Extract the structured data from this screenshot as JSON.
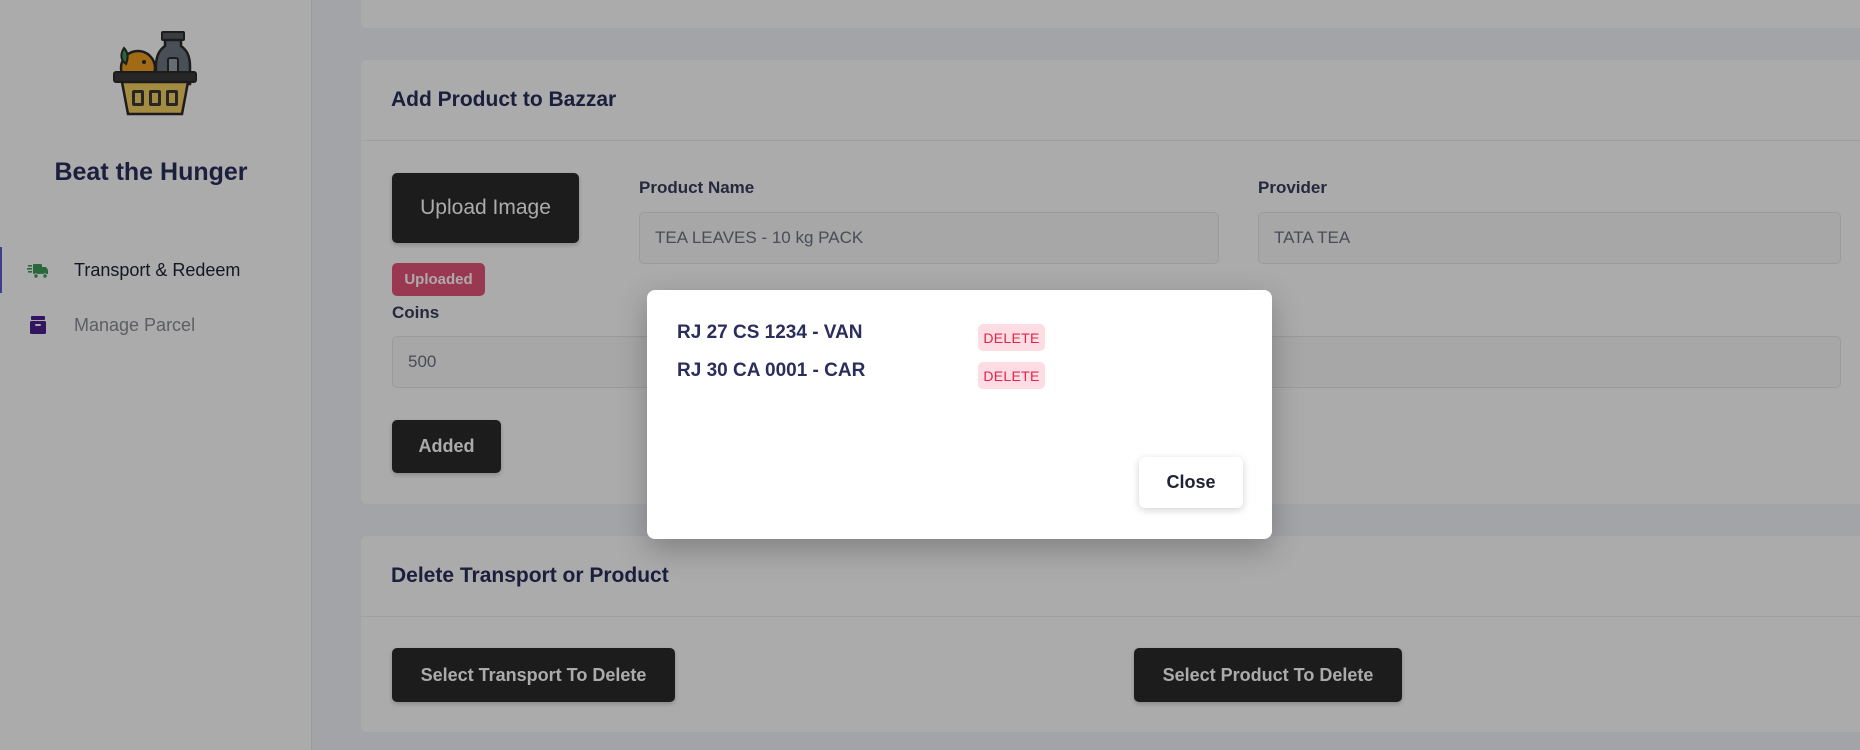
{
  "sidebar": {
    "brand": "Beat the Hunger",
    "items": [
      {
        "label": "Transport & Redeem",
        "icon": "delivery-truck-icon"
      },
      {
        "label": "Manage Parcel",
        "icon": "parcel-box-icon"
      }
    ]
  },
  "add_product": {
    "title": "Add Product to Bazzar",
    "upload_label": "Upload Image",
    "uploaded_badge": "Uploaded",
    "product_name_label": "Product Name",
    "product_name_value": "TEA LEAVES - 10 kg PACK",
    "provider_label": "Provider",
    "provider_value": "TATA TEA",
    "coins_label": "Coins",
    "coins_value": "500",
    "added_label": "Added"
  },
  "delete_section": {
    "title": "Delete Transport or Product",
    "select_transport_label": "Select Transport To Delete",
    "select_product_label": "Select Product To Delete"
  },
  "modal": {
    "vehicles": [
      {
        "name": "RJ 27 CS 1234 - VAN",
        "action": "DELETE"
      },
      {
        "name": "RJ 30 CA 0001 - CAR",
        "action": "DELETE"
      }
    ],
    "close_label": "Close"
  },
  "colors": {
    "accent": "#5b5fd6",
    "dark_button": "#2b2b2b",
    "uploaded_badge": "#e8547a",
    "delete_badge_bg": "#fddde3",
    "delete_badge_text": "#e2234a"
  }
}
